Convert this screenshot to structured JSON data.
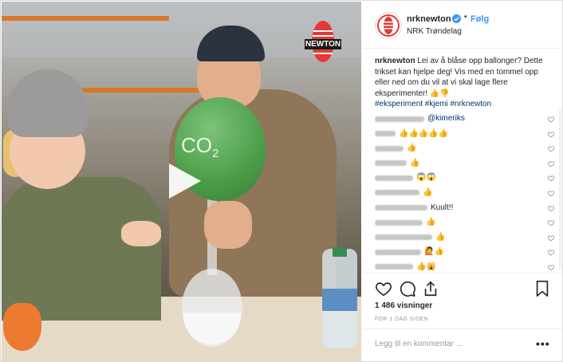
{
  "media": {
    "balloon_label": "CO",
    "balloon_label_sub": "2",
    "brand_badge": "NEWTON"
  },
  "header": {
    "username": "nrknewton",
    "dot": "•",
    "follow_label": "Følg",
    "location": "NRK Trøndelag"
  },
  "caption": {
    "username": "nrknewton",
    "text": "Lei av å blåse opp ballonger? Dette trikset kan hjelpe deg! Vis med en tommel opp eller ned om du vil at vi skal lage flere eksperimenter! 👍👎",
    "hashtags": "#eksperiment #kjemi #nrknewton"
  },
  "comments": [
    {
      "mention": "@kimeriks",
      "text": ""
    },
    {
      "mention": "",
      "text": "👍👍👍👍👍"
    },
    {
      "mention": "",
      "text": "👍"
    },
    {
      "mention": "",
      "text": "👍"
    },
    {
      "mention": "",
      "text": "😱😱"
    },
    {
      "mention": "",
      "text": "👍"
    },
    {
      "mention": "",
      "text": "Kuult!!"
    },
    {
      "mention": "",
      "text": "👍"
    },
    {
      "mention": "",
      "text": "👍"
    },
    {
      "mention": "",
      "text": "🙋👍"
    },
    {
      "mention": "",
      "text": "👍🙀"
    }
  ],
  "stats": {
    "views": "1 486 visninger",
    "time": "FOR 1 DAG SIDEN"
  },
  "add_comment": {
    "placeholder": "Legg til en kommentar ...",
    "more": "•••"
  },
  "colors": {
    "link_blue": "#3897f0",
    "hashtag": "#003569",
    "muted": "#999999"
  }
}
